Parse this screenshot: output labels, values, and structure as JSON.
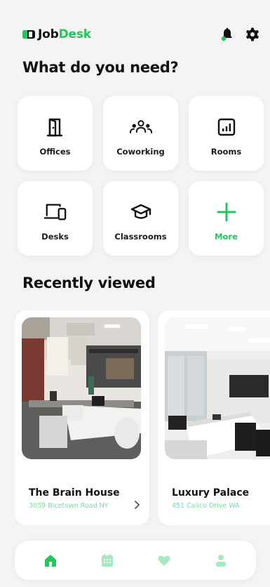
{
  "header": {
    "logo_part1": "Job",
    "logo_part2": "Desk",
    "icons": [
      "bell-icon",
      "gear-icon"
    ]
  },
  "main": {
    "title": "What do you need?",
    "categories": [
      {
        "label": "Offices",
        "icon": "door-icon"
      },
      {
        "label": "Coworking",
        "icon": "people-group-icon"
      },
      {
        "label": "Rooms",
        "icon": "room-chart-icon"
      },
      {
        "label": "Desks",
        "icon": "devices-icon"
      },
      {
        "label": "Classrooms",
        "icon": "graduation-cap-icon"
      },
      {
        "label": "More",
        "icon": "plus-icon"
      }
    ]
  },
  "recent": {
    "title": "Recently viewed",
    "cards": [
      {
        "name": "The Brain House",
        "address": "3059 Bicetown Road NY"
      },
      {
        "name": "Luxury Palace",
        "address": "451 Calico Drive WA"
      }
    ]
  },
  "nav": {
    "items": [
      "home-icon",
      "calendar-icon",
      "heart-icon",
      "profile-icon"
    ],
    "active": "home-icon"
  },
  "colors": {
    "accent": "#22c55e",
    "accent_light": "#a7e9bf",
    "background": "#f4f4f4",
    "text": "#111111"
  }
}
